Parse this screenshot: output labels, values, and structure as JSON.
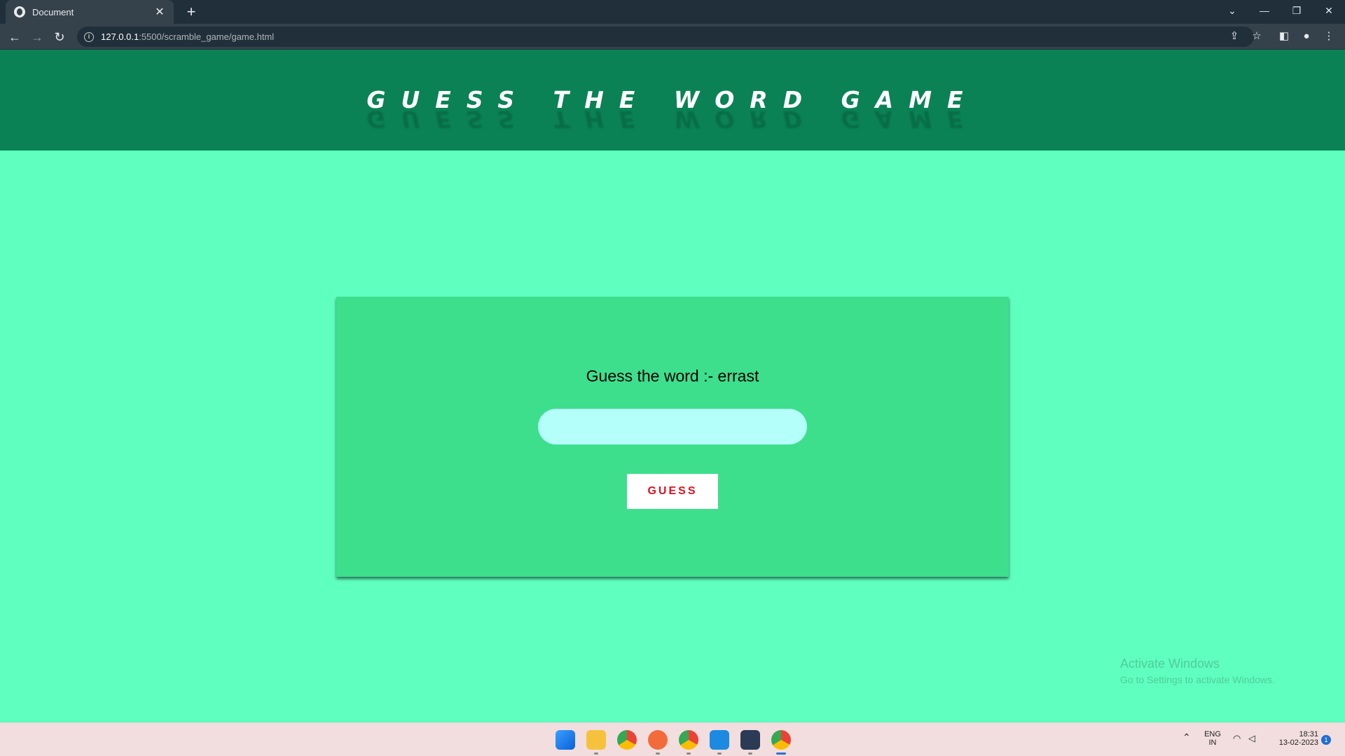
{
  "browser": {
    "tab_title": "Document",
    "url_host": "127.0.0.1",
    "url_path": ":5500/scramble_game/game.html"
  },
  "page": {
    "title": "Guess the word game",
    "prompt": "Guess the word :- errast",
    "input_value": "",
    "guess_button_label": "GUESS"
  },
  "watermark": {
    "line1": "Activate Windows",
    "line2": "Go to Settings to activate Windows."
  },
  "system_tray": {
    "language": "ENG",
    "region": "IN",
    "time": "18:31",
    "date": "13-02-2023",
    "notification_count": "1"
  },
  "colors": {
    "page_background": "#5effbf",
    "header_background": "#0a8255",
    "card_background": "#3ddf8d",
    "input_background": "#b4fff9",
    "button_text": "#e0101e"
  }
}
